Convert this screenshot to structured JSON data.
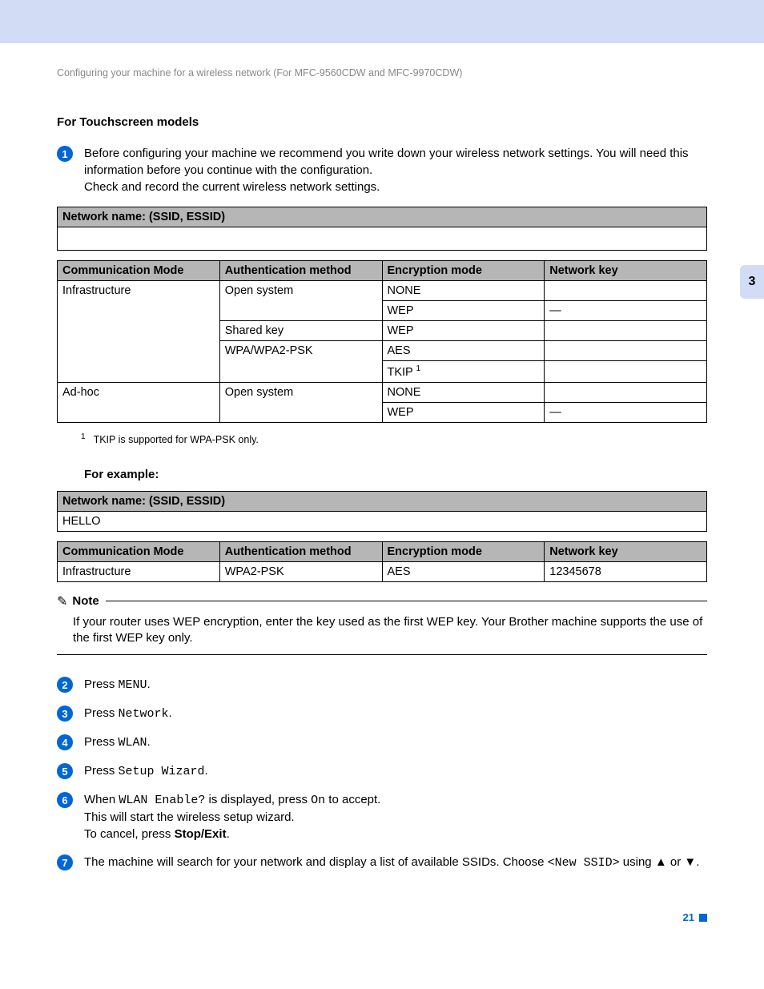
{
  "breadcrumb": "Configuring your machine for a wireless network (For MFC-9560CDW and MFC-9970CDW)",
  "side_tab": "3",
  "page_number": "21",
  "heading_touchscreen": "For Touchscreen models",
  "step1": {
    "line1": "Before configuring your machine we recommend you write down your wireless network settings. You will need this information before you continue with the configuration.",
    "line2": "Check and record the current wireless network settings."
  },
  "table1_header": "Network name: (SSID, ESSID)",
  "table2": {
    "headers": [
      "Communication Mode",
      "Authentication method",
      "Encryption mode",
      "Network key"
    ],
    "rows": [
      {
        "c0": "Infrastructure",
        "c1": "Open system",
        "c2": "NONE",
        "c3": "",
        "rs0": 5,
        "rs1": 2
      },
      {
        "c2": "WEP",
        "c3": "—"
      },
      {
        "c1": "Shared key",
        "c2": "WEP",
        "c3": ""
      },
      {
        "c1": "WPA/WPA2-PSK",
        "c2": "AES",
        "c3": "",
        "rs1": 2
      },
      {
        "c2_html": "TKIP <sup>1</sup>",
        "c3": ""
      },
      {
        "c0": "Ad-hoc",
        "c1": "Open system",
        "c2": "NONE",
        "c3": "",
        "rs0": 2,
        "rs1": 2
      },
      {
        "c2": "WEP",
        "c3": "—"
      }
    ]
  },
  "footnote": "TKIP is supported for WPA-PSK only.",
  "for_example": "For example:",
  "table3_header": "Network name: (SSID, ESSID)",
  "table3_value": "HELLO",
  "table4": {
    "headers": [
      "Communication Mode",
      "Authentication method",
      "Encryption mode",
      "Network key"
    ],
    "row": {
      "c0": "Infrastructure",
      "c1": "WPA2-PSK",
      "c2": "AES",
      "c3": "12345678"
    }
  },
  "note": {
    "label": "Note",
    "text": "If your router uses WEP encryption, enter the key used as the first WEP key. Your Brother machine supports the use of the first WEP key only."
  },
  "steps": {
    "s2": {
      "press": "Press ",
      "target": "MENU",
      "after": "."
    },
    "s3": {
      "press": "Press ",
      "target": "Network",
      "after": "."
    },
    "s4": {
      "press": "Press ",
      "target": "WLAN",
      "after": "."
    },
    "s5": {
      "press": "Press ",
      "target": "Setup Wizard",
      "after": "."
    },
    "s6": {
      "when": "When ",
      "wlan_enable": "WLAN Enable?",
      "displayed": " is displayed, press ",
      "on": "On",
      "accept": " to accept.",
      "line2": "This will start the wireless setup wizard.",
      "line3a": "To cancel, press ",
      "stopexit": "Stop/Exit",
      "line3b": "."
    },
    "s7": {
      "a": "The machine will search for your network and display a list of available SSIDs. Choose ",
      "newssid": "<New SSID>",
      "b": " using ",
      "up": "▲",
      "or": " or ",
      "down": "▼",
      "end": "."
    }
  }
}
